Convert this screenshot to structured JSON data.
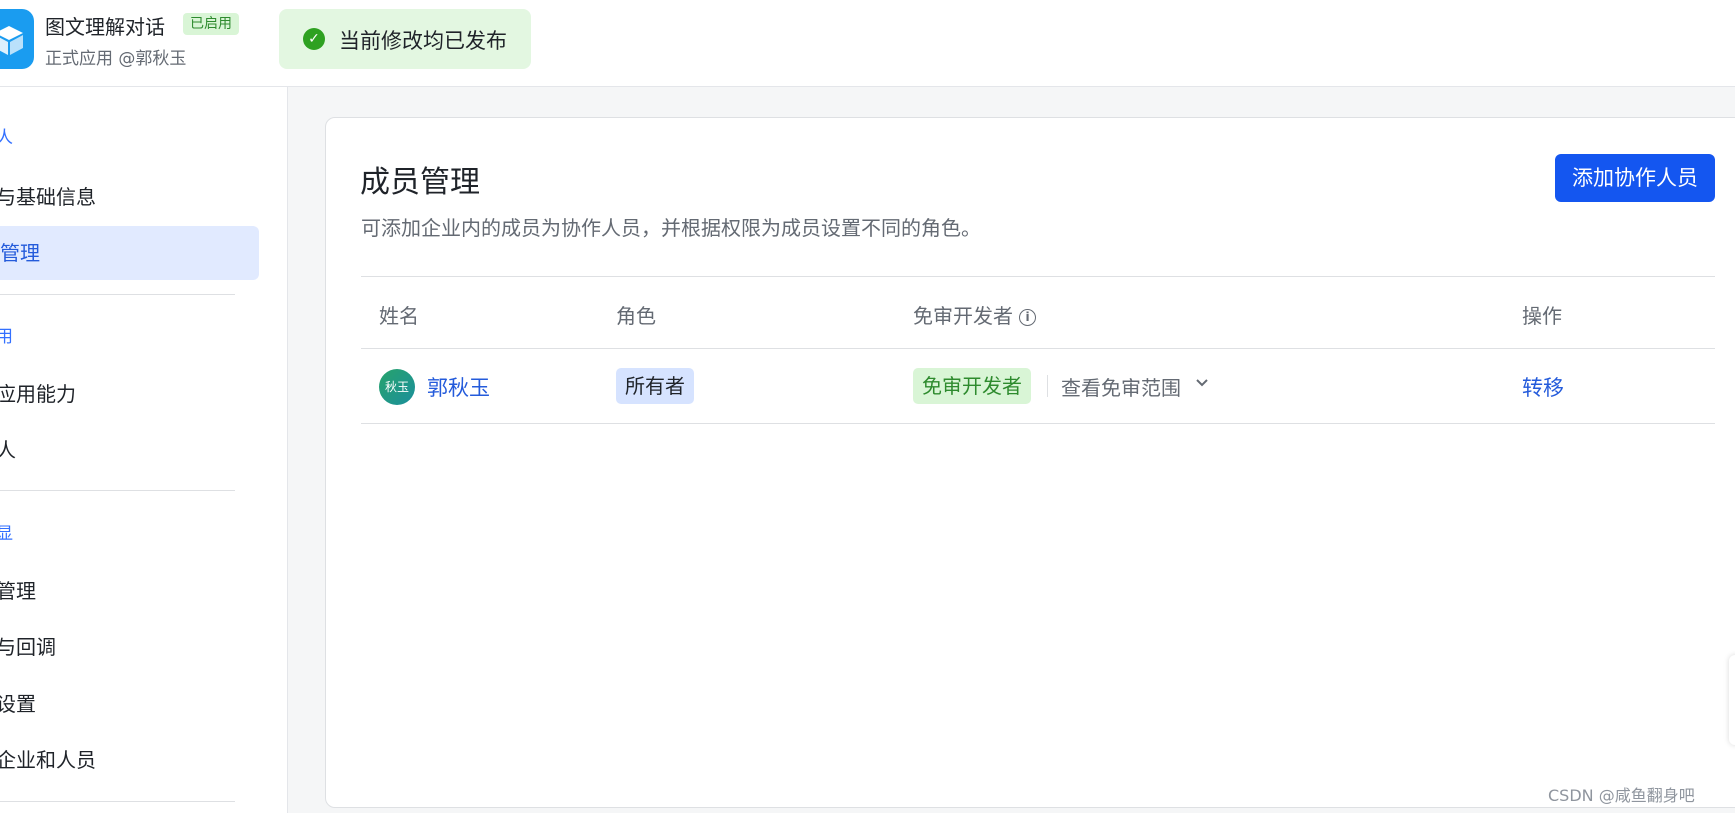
{
  "header": {
    "app_name": "图文理解对话",
    "app_status": "已启用",
    "app_subtitle": "正式应用 @郭秋玉",
    "toast": "当前修改均已发布"
  },
  "sidebar": {
    "groups": [
      "人",
      "用",
      "显"
    ],
    "items": [
      {
        "label": "与基础信息"
      },
      {
        "label": "管理",
        "active": true
      },
      {
        "label": "应用能力"
      },
      {
        "label": "人"
      },
      {
        "label": "管理"
      },
      {
        "label": "与回调"
      },
      {
        "label": "设置"
      },
      {
        "label": "企业和人员"
      }
    ]
  },
  "main": {
    "title": "成员管理",
    "description": "可添加企业内的成员为协作人员，并根据权限为成员设置不同的角色。",
    "add_button": "添加协作人员",
    "columns": [
      "姓名",
      "角色",
      "免审开发者",
      "操作"
    ],
    "rows": [
      {
        "avatar_text": "秋玉",
        "name": "郭秋玉",
        "role": "所有者",
        "exempt_tag": "免审开发者",
        "scope_link": "查看免审范围",
        "action": "转移"
      }
    ]
  },
  "watermark": "CSDN @咸鱼翻身吧",
  "colors": {
    "primary": "#1456f0",
    "link": "#245bdb",
    "success": "#2ea121",
    "sidebar_active_bg": "#e1eaff",
    "toast_bg": "#e3f7e1"
  },
  "icons": {
    "app_logo": "cube-logo-icon",
    "toast": "check-circle-icon",
    "info": "info-circle-icon",
    "dropdown": "chevron-down-icon"
  }
}
